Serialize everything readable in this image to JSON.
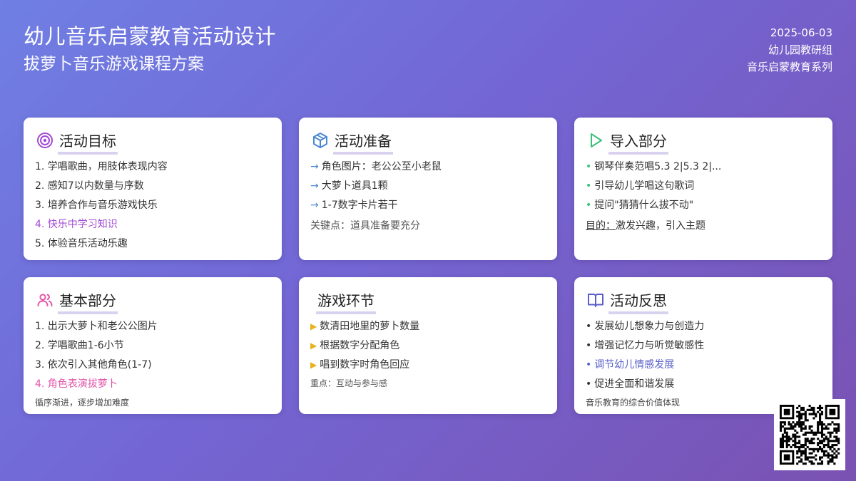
{
  "header": {
    "title": "幼儿音乐启蒙教育活动设计",
    "subtitle": "拔萝卜音乐游戏课程方案",
    "date": "2025-06-03",
    "group": "幼儿园教研组",
    "series": "音乐启蒙教育系列"
  },
  "colors": {
    "purple": "#a24ad6",
    "blue": "#4a86d6",
    "green": "#3bbf7a",
    "pink": "#e255a8",
    "yellow": "#e8b21c",
    "indigo": "#5a5fc9"
  },
  "cards": {
    "goals": {
      "icon": "target-icon",
      "title": "活动目标",
      "items": [
        "1. 学唱歌曲，用肢体表现内容",
        "2. 感知7以内数量与序数",
        "3. 培养合作与音乐游戏快乐",
        "4. 快乐中学习知识",
        "5. 体验音乐活动乐趣"
      ]
    },
    "prep": {
      "icon": "box-icon",
      "title": "活动准备",
      "marker": "→",
      "items": [
        "角色图片：老公公至小老鼠",
        "大萝卜道具1颗",
        "1-7数字卡片若干"
      ],
      "note": "关键点：道具准备要充分"
    },
    "intro": {
      "icon": "play-icon",
      "title": "导入部分",
      "marker": "•",
      "items": [
        "钢琴伴奏范唱5.3 2|5.3 2|...",
        "引导幼儿学唱这句歌词",
        "提问\"猜猜什么拔不动\""
      ],
      "note_label": "目的：",
      "note_text": "激发兴趣，引入主题"
    },
    "basic": {
      "icon": "users-icon",
      "title": "基本部分",
      "items": [
        "1. 出示大萝卜和老公公图片",
        "2. 学唱歌曲1-6小节",
        "3. 依次引入其他角色(1-7)",
        "4. 角色表演拔萝卜"
      ],
      "note": "循序渐进，逐步增加难度"
    },
    "game": {
      "title": "游戏环节",
      "marker": "▶",
      "items": [
        "数清田地里的萝卜数量",
        "根据数字分配角色",
        "唱到数字时角色回应"
      ],
      "note": "重点：互动与参与感"
    },
    "reflect": {
      "icon": "book-icon",
      "title": "活动反思",
      "marker": "•",
      "items": [
        "发展幼儿想象力与创造力",
        "增强记忆力与听觉敏感性",
        "调节幼儿情感发展",
        "促进全面和谐发展"
      ],
      "note": "音乐教育的综合价值体现"
    }
  },
  "qr": {
    "icon": "qr-code-icon"
  }
}
